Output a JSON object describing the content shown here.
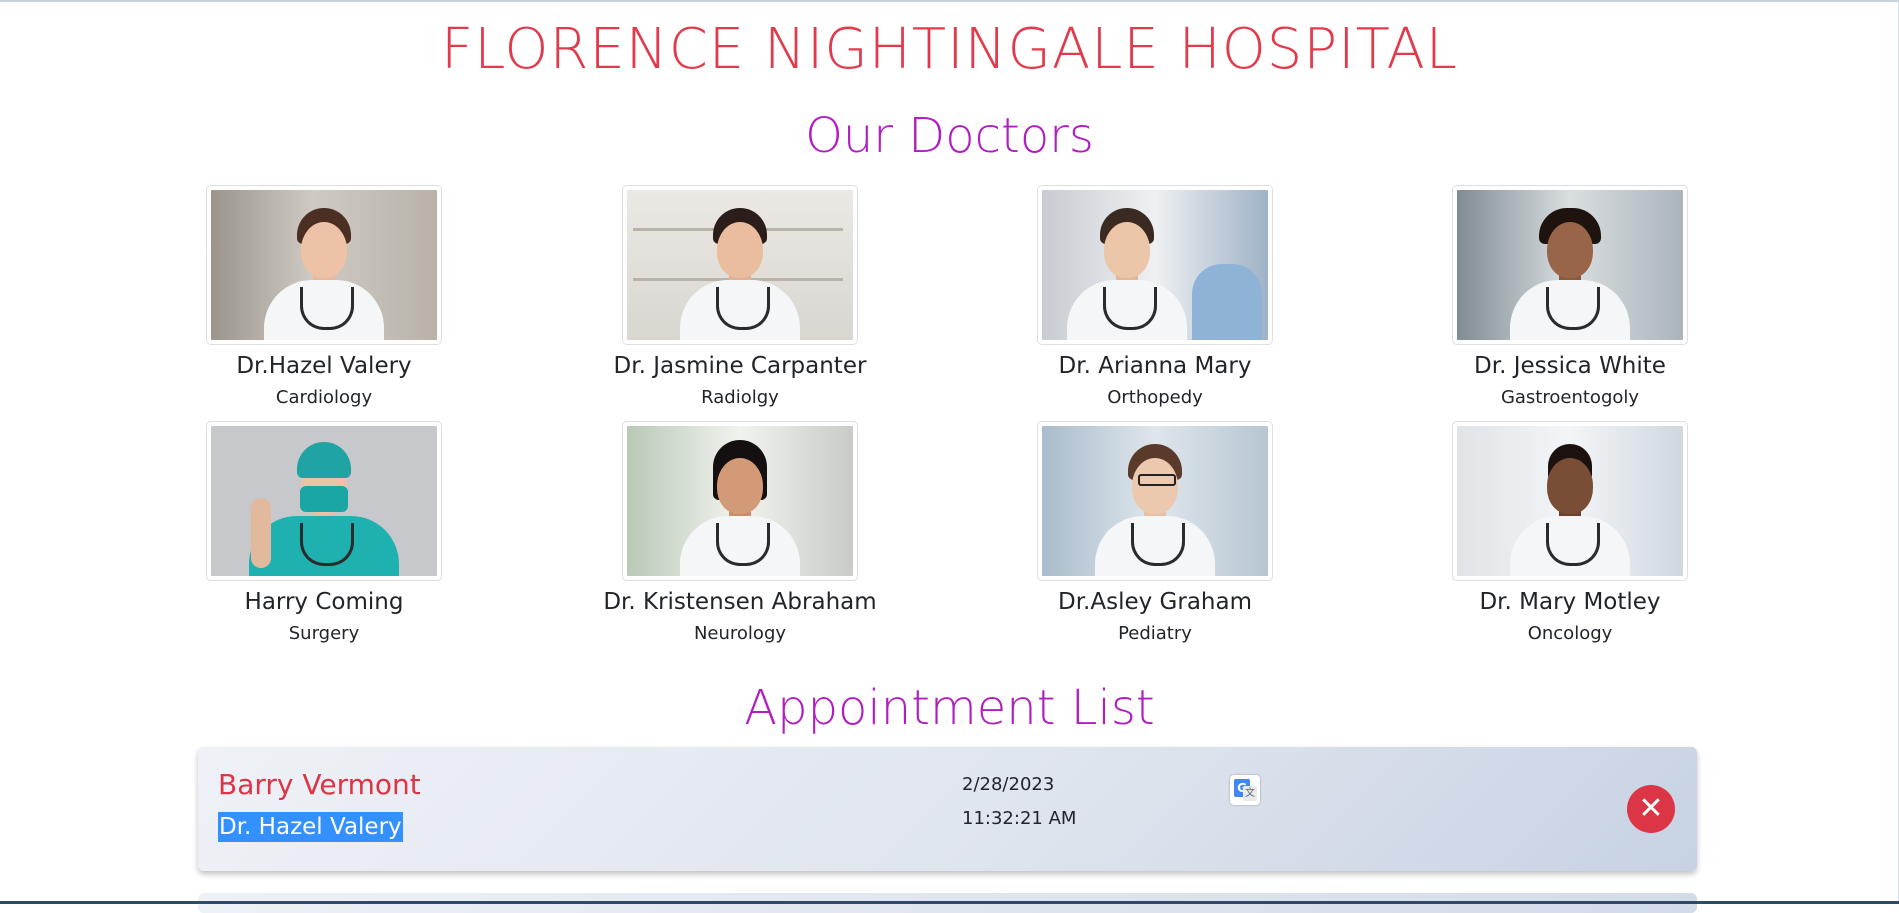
{
  "header": {
    "title": "FLORENCE NIGHTINGALE HOSPITAL"
  },
  "doctors_section": {
    "title": "Our Doctors"
  },
  "doctors": [
    {
      "name": "Dr.Hazel Valery",
      "department": "Cardiology"
    },
    {
      "name": "Dr. Jasmine Carpanter",
      "department": "Radiolgy"
    },
    {
      "name": "Dr. Arianna Mary",
      "department": "Orthopedy"
    },
    {
      "name": "Dr. Jessica White",
      "department": "Gastroentogoly"
    },
    {
      "name": "Harry Coming",
      "department": "Surgery"
    },
    {
      "name": "Dr. Kristensen Abraham",
      "department": "Neurology"
    },
    {
      "name": "Dr.Asley Graham",
      "department": "Pediatry"
    },
    {
      "name": "Dr. Mary Motley",
      "department": "Oncology"
    }
  ],
  "appointments_section": {
    "title": "Appointment List"
  },
  "appointments": [
    {
      "patient": "Barry Vermont",
      "doctor": "Dr. Hazel Valery",
      "date": "2/28/2023",
      "time": "11:32:21 AM"
    }
  ],
  "colors": {
    "title": "#e23a4a",
    "section": "#b01ec0",
    "patient": "#dc3545",
    "delete": "#dc3545"
  },
  "icons": {
    "translate": "google-translate-icon",
    "delete": "close-circle-icon"
  }
}
